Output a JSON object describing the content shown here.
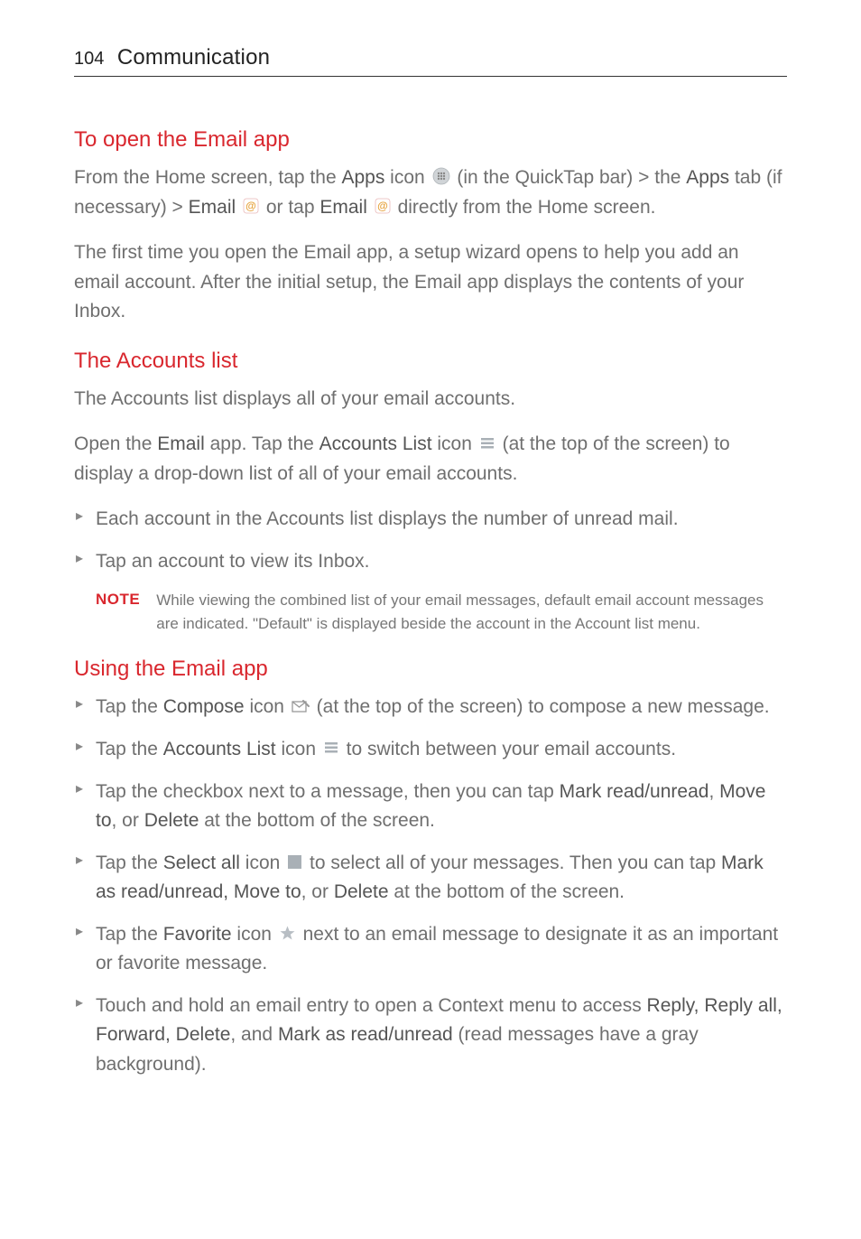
{
  "header": {
    "page_number": "104",
    "section": "Communication"
  },
  "h1": "To open the Email app",
  "p1_parts": {
    "a": "From the Home screen, tap the ",
    "b": "Apps",
    "c": " icon ",
    "d": " (in the QuickTap bar) > the ",
    "e": "Apps",
    "f": " tab (if necessary) > ",
    "g": "Email",
    "h": " or tap ",
    "i": "Email",
    "j": " directly from the Home screen."
  },
  "p2": "The first time you open the Email app, a setup wizard opens to help you add an email account. After the initial setup, the Email app displays the contents of your Inbox.",
  "h2": "The Accounts list",
  "p3": "The Accounts list displays all of your email accounts.",
  "p4_parts": {
    "a": "Open the ",
    "b": "Email",
    "c": " app. Tap the ",
    "d": "Accounts List",
    "e": " icon ",
    "f": " (at the top of the screen) to display a drop-down list of all of your email accounts."
  },
  "list1": {
    "i1": "Each account in the Accounts list displays the number of unread mail.",
    "i2": "Tap an account to view its Inbox."
  },
  "note": {
    "label": "NOTE",
    "text": "While viewing the combined list of your email messages, default email account messages are indicated. \"Default\" is displayed beside the account in the Account list menu."
  },
  "h3": "Using the Email app",
  "list2": {
    "i1": {
      "a": "Tap the ",
      "b": "Compose",
      "c": " icon ",
      "d": " (at the top of the screen) to compose a new message."
    },
    "i2": {
      "a": "Tap the ",
      "b": "Accounts List",
      "c": " icon ",
      "d": " to switch between your email accounts."
    },
    "i3": {
      "a": "Tap the checkbox next to a message, then you can tap ",
      "b": "Mark read/unread",
      "c": ", ",
      "d": "Move to",
      "e": ", or ",
      "f": "Delete",
      "g": " at the bottom of the screen."
    },
    "i4": {
      "a": "Tap the ",
      "b": "Select all",
      "c": " icon ",
      "d": " to select all of your messages. Then you can tap ",
      "e": "Mark as read/unread, Move to",
      "f": ", or ",
      "g": "Delete",
      "h": " at the bottom of the screen."
    },
    "i5": {
      "a": "Tap the ",
      "b": "Favorite",
      "c": " icon ",
      "d": " next to an email message to designate it as an important or favorite message."
    },
    "i6": {
      "a": "Touch and hold an email entry to open a Context menu to access ",
      "b": "Reply, Reply all, Forward, Delete",
      "c": ", and ",
      "d": "Mark as read/unread",
      "e": " (read messages have a gray background)."
    }
  }
}
